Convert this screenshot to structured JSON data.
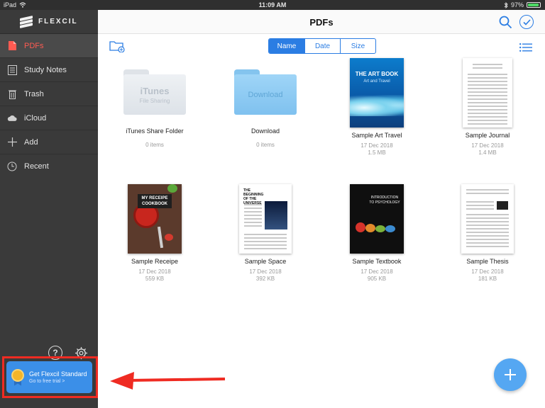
{
  "status": {
    "device": "iPad",
    "time": "11:09 AM",
    "battery": "97%"
  },
  "sidebar": {
    "brand": "FLEXCIL",
    "items": [
      {
        "label": "PDFs",
        "icon": "pdf-icon"
      },
      {
        "label": "Study Notes",
        "icon": "notebook-icon"
      },
      {
        "label": "Trash",
        "icon": "trash-icon"
      },
      {
        "label": "iCloud",
        "icon": "cloud-icon"
      },
      {
        "label": "Add",
        "icon": "plus-icon"
      },
      {
        "label": "Recent",
        "icon": "clock-icon"
      }
    ],
    "help_glyph": "?",
    "promo": {
      "title": "Get Flexcil Standard",
      "subtitle": "Go to free trial >"
    }
  },
  "main": {
    "title": "PDFs",
    "sort_tabs": [
      "Name",
      "Date",
      "Size"
    ],
    "items": [
      {
        "name": "iTunes Share Folder",
        "meta1": "0 items",
        "folder_line1": "iTunes",
        "folder_line2": "File Sharing"
      },
      {
        "name": "Download",
        "meta1": "0 items",
        "folder_line1": "Download"
      },
      {
        "name": "Sample Art Travel",
        "meta1": "17 Dec 2018",
        "meta2": "1.5 MB",
        "cover_title": "THE ART BOOK",
        "cover_sub": "Art and Travel"
      },
      {
        "name": "Sample Journal",
        "meta1": "17 Dec 2018",
        "meta2": "1.4 MB"
      },
      {
        "name": "Sample Receipe",
        "meta1": "17 Dec 2018",
        "meta2": "559 KB",
        "cover_title": "MY RECEIPE COOKBOOK"
      },
      {
        "name": "Sample Space",
        "meta1": "17 Dec 2018",
        "meta2": "392 KB",
        "cover_title": "THE BEGINNING OF THE UNIVERSE"
      },
      {
        "name": "Sample Textbook",
        "meta1": "17 Dec 2018",
        "meta2": "905 KB",
        "cover_title": "INTRODUCTION TO PSYCHOLOGY"
      },
      {
        "name": "Sample Thesis",
        "meta1": "17 Dec 2018",
        "meta2": "181 KB"
      }
    ]
  },
  "colors": {
    "accent": "#2b7de3",
    "active_nav": "#ff5b52",
    "sidebar_bg": "#3a3a3a",
    "promo_bg": "#3b8fe8",
    "annotation": "#ef2b22"
  }
}
